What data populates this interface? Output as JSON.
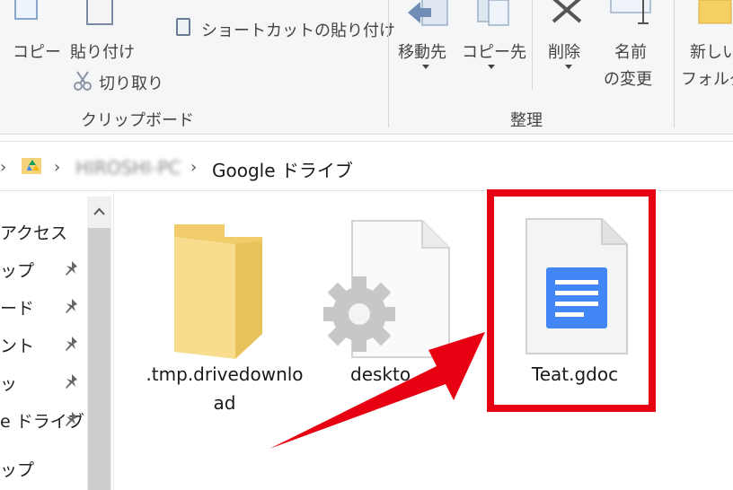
{
  "ribbon": {
    "clipboard": {
      "copy": "コピー",
      "paste": "貼り付け",
      "paste_shortcut": "ショートカットの貼り付け",
      "cut": "切り取り",
      "group_label": "クリップボード"
    },
    "organize": {
      "move_to": "移動先",
      "copy_to": "コピー先",
      "delete": "削除",
      "rename_line1": "名前",
      "rename_line2": "の変更",
      "group_label": "整理"
    },
    "new": {
      "new_folder_line1": "新しい",
      "new_folder_line2": "フォルダ"
    }
  },
  "address_bar": {
    "computer_name": "HIROSHI-PC",
    "current_folder": "Google ドライブ"
  },
  "nav_pane": {
    "items": [
      "アクセス",
      "ップ",
      "ード",
      "ント",
      "ッ",
      "e ドライブ",
      "ップ"
    ]
  },
  "files": [
    {
      "name_line1": ".tmp.drivedownlo",
      "name_line2": "ad",
      "type": "folder-icon"
    },
    {
      "name_line1": "deskto",
      "name_line2": "",
      "type": "settings-file-icon"
    },
    {
      "name_line1": "Teat.gdoc",
      "name_line2": "",
      "type": "google-doc-icon"
    }
  ],
  "colors": {
    "highlight": "#e60012",
    "folder": "#f7d87c",
    "gdoc_blue": "#4285f4"
  }
}
